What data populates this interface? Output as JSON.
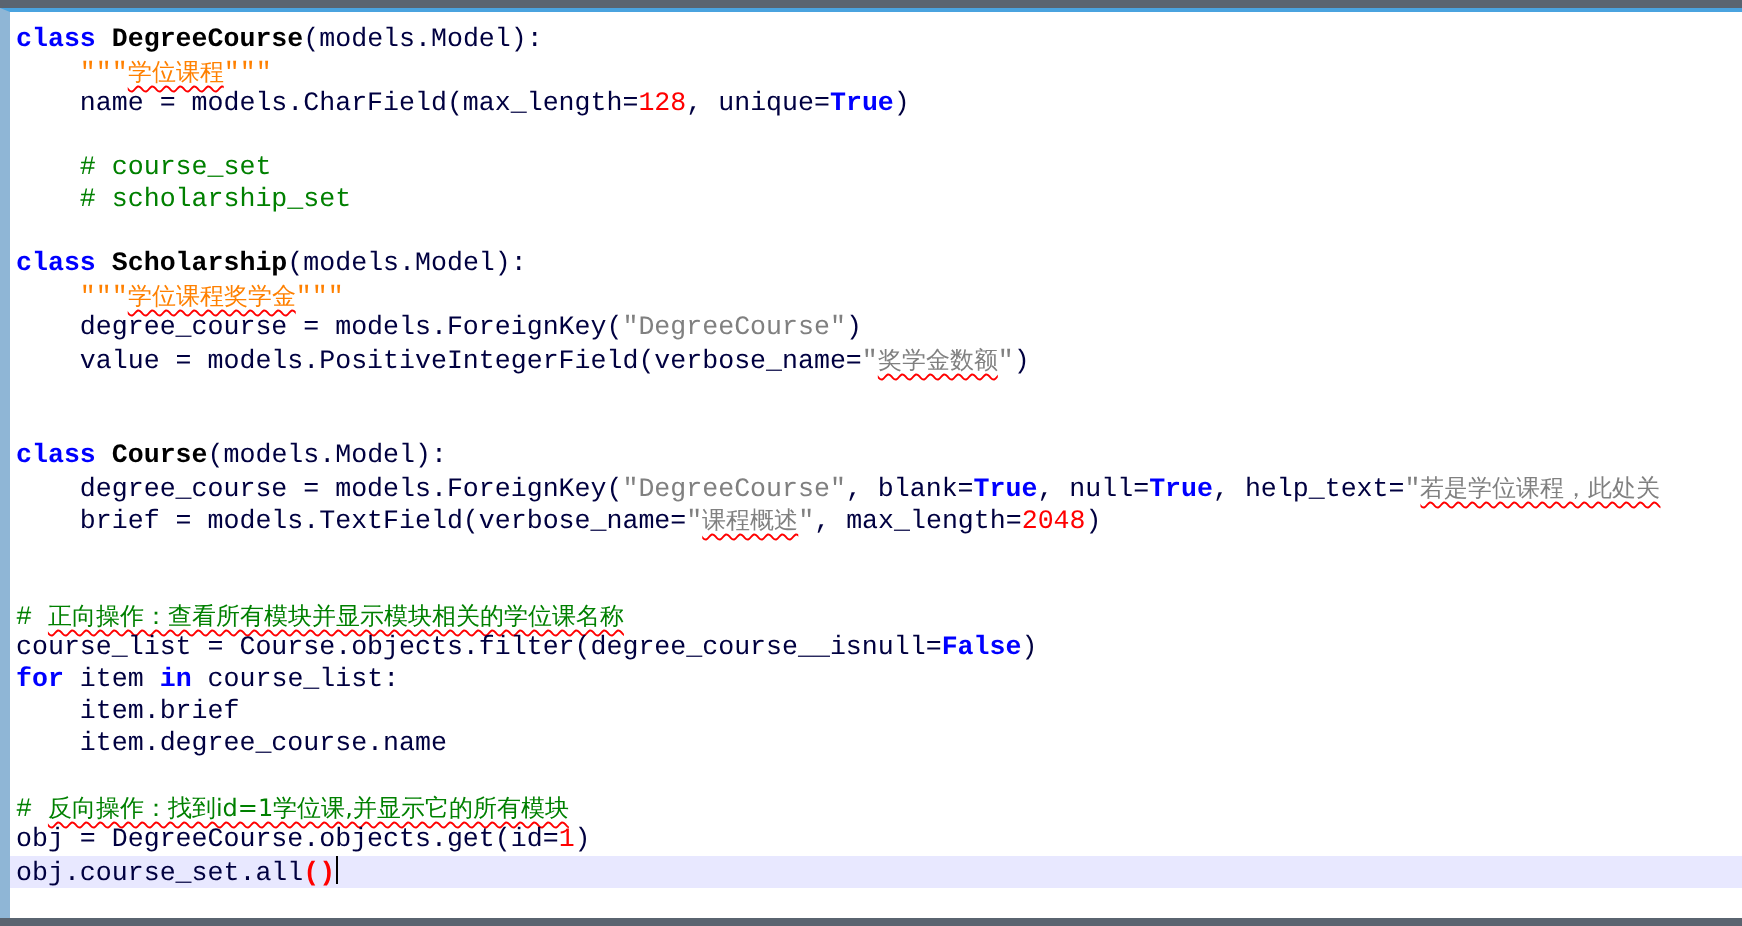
{
  "editor": {
    "lines": [
      {
        "current": false,
        "tokens": [
          {
            "kind": "keyword",
            "text": "class ",
            "flagged": false
          },
          {
            "kind": "name",
            "text": "DegreeCourse",
            "flagged": false
          },
          {
            "kind": "plain",
            "text": "(models.Model):",
            "flagged": false
          }
        ]
      },
      {
        "current": false,
        "tokens": [
          {
            "kind": "docstring",
            "text": "    \"\"\"",
            "flagged": false
          },
          {
            "kind": "docstring",
            "text": "学位课程",
            "flagged": true
          },
          {
            "kind": "docstring",
            "text": "\"\"\"",
            "flagged": false
          }
        ]
      },
      {
        "current": false,
        "tokens": [
          {
            "kind": "plain",
            "text": "    name = models.CharField(max_length=",
            "flagged": false
          },
          {
            "kind": "number",
            "text": "128",
            "flagged": false
          },
          {
            "kind": "plain",
            "text": ", unique=",
            "flagged": false
          },
          {
            "kind": "constant",
            "text": "True",
            "flagged": false
          },
          {
            "kind": "plain",
            "text": ")",
            "flagged": false
          }
        ]
      },
      {
        "current": false
      },
      {
        "current": false,
        "tokens": [
          {
            "kind": "comment",
            "text": "    # course_set",
            "flagged": false
          }
        ]
      },
      {
        "current": false,
        "tokens": [
          {
            "kind": "comment",
            "text": "    # scholarship_set",
            "flagged": false
          }
        ]
      },
      {
        "current": false
      },
      {
        "current": false,
        "tokens": [
          {
            "kind": "keyword",
            "text": "class ",
            "flagged": false
          },
          {
            "kind": "name",
            "text": "Scholarship",
            "flagged": false
          },
          {
            "kind": "plain",
            "text": "(models.Model):",
            "flagged": false
          }
        ]
      },
      {
        "current": false,
        "tokens": [
          {
            "kind": "docstring",
            "text": "    \"\"\"",
            "flagged": false
          },
          {
            "kind": "docstring",
            "text": "学位课程奖学金",
            "flagged": true
          },
          {
            "kind": "docstring",
            "text": "\"\"\"",
            "flagged": false
          }
        ]
      },
      {
        "current": false,
        "tokens": [
          {
            "kind": "plain",
            "text": "    degree_course = models.ForeignKey(",
            "flagged": false
          },
          {
            "kind": "string",
            "text": "\"DegreeCourse\"",
            "flagged": false
          },
          {
            "kind": "plain",
            "text": ")",
            "flagged": false
          }
        ]
      },
      {
        "current": false,
        "tokens": [
          {
            "kind": "plain",
            "text": "    value = models.PositiveIntegerField(verbose_name=",
            "flagged": false
          },
          {
            "kind": "string",
            "text": "\"",
            "flagged": false
          },
          {
            "kind": "string",
            "text": "奖学金数额",
            "flagged": true
          },
          {
            "kind": "string",
            "text": "\"",
            "flagged": false
          },
          {
            "kind": "plain",
            "text": ")",
            "flagged": false
          }
        ]
      },
      {
        "current": false
      },
      {
        "current": false
      },
      {
        "current": false,
        "tokens": [
          {
            "kind": "keyword",
            "text": "class ",
            "flagged": false
          },
          {
            "kind": "name",
            "text": "Course",
            "flagged": false
          },
          {
            "kind": "plain",
            "text": "(models.Model):",
            "flagged": false
          }
        ]
      },
      {
        "current": false,
        "tokens": [
          {
            "kind": "plain",
            "text": "    degree_course = models.ForeignKey(",
            "flagged": false
          },
          {
            "kind": "string",
            "text": "\"DegreeCourse\"",
            "flagged": false
          },
          {
            "kind": "plain",
            "text": ", blank=",
            "flagged": false
          },
          {
            "kind": "constant",
            "text": "True",
            "flagged": false
          },
          {
            "kind": "plain",
            "text": ", null=",
            "flagged": false
          },
          {
            "kind": "constant",
            "text": "True",
            "flagged": false
          },
          {
            "kind": "plain",
            "text": ", help_text=",
            "flagged": false
          },
          {
            "kind": "string",
            "text": "\"",
            "flagged": false
          },
          {
            "kind": "string",
            "text": "若是学位课程，此处关",
            "flagged": true
          }
        ]
      },
      {
        "current": false,
        "tokens": [
          {
            "kind": "plain",
            "text": "    brief = models.TextField(verbose_name=",
            "flagged": false
          },
          {
            "kind": "string",
            "text": "\"",
            "flagged": false
          },
          {
            "kind": "string",
            "text": "课程概述",
            "flagged": true
          },
          {
            "kind": "string",
            "text": "\"",
            "flagged": false
          },
          {
            "kind": "plain",
            "text": ", max_length=",
            "flagged": false
          },
          {
            "kind": "number",
            "text": "2048",
            "flagged": false
          },
          {
            "kind": "plain",
            "text": ")",
            "flagged": false
          }
        ]
      },
      {
        "current": false
      },
      {
        "current": false
      },
      {
        "current": false,
        "tokens": [
          {
            "kind": "comment",
            "text": "# ",
            "flagged": false
          },
          {
            "kind": "comment",
            "text": "正向操作：查看所有模块并显示模块相关的学位课名称",
            "flagged": true
          }
        ]
      },
      {
        "current": false,
        "tokens": [
          {
            "kind": "plain",
            "text": "course_list = Course.objects.filter(degree_course__isnull=",
            "flagged": false
          },
          {
            "kind": "constant",
            "text": "False",
            "flagged": false
          },
          {
            "kind": "plain",
            "text": ")",
            "flagged": false
          }
        ]
      },
      {
        "current": false,
        "tokens": [
          {
            "kind": "keyword",
            "text": "for",
            "flagged": false
          },
          {
            "kind": "plain",
            "text": " item ",
            "flagged": false
          },
          {
            "kind": "keyword",
            "text": "in",
            "flagged": false
          },
          {
            "kind": "plain",
            "text": " course_list:",
            "flagged": false
          }
        ]
      },
      {
        "current": false,
        "tokens": [
          {
            "kind": "plain",
            "text": "    item.brief",
            "flagged": false
          }
        ]
      },
      {
        "current": false,
        "tokens": [
          {
            "kind": "plain",
            "text": "    item.degree_course.name",
            "flagged": false
          }
        ]
      },
      {
        "current": false
      },
      {
        "current": false,
        "tokens": [
          {
            "kind": "comment",
            "text": "# ",
            "flagged": false
          },
          {
            "kind": "comment",
            "text": "反向操作：找到id=1学位课,并显示它的所有模块",
            "flagged": true
          }
        ]
      },
      {
        "current": false,
        "tokens": [
          {
            "kind": "plain",
            "text": "obj = DegreeCourse.objects.get(id=",
            "flagged": false
          },
          {
            "kind": "number",
            "text": "1",
            "flagged": false
          },
          {
            "kind": "plain",
            "text": ")",
            "flagged": false
          }
        ]
      },
      {
        "current": true,
        "tokens": [
          {
            "kind": "plain",
            "text": "obj.course_set.all",
            "flagged": false
          },
          {
            "kind": "brace_match",
            "text": "()",
            "flagged": false
          }
        ]
      }
    ]
  }
}
